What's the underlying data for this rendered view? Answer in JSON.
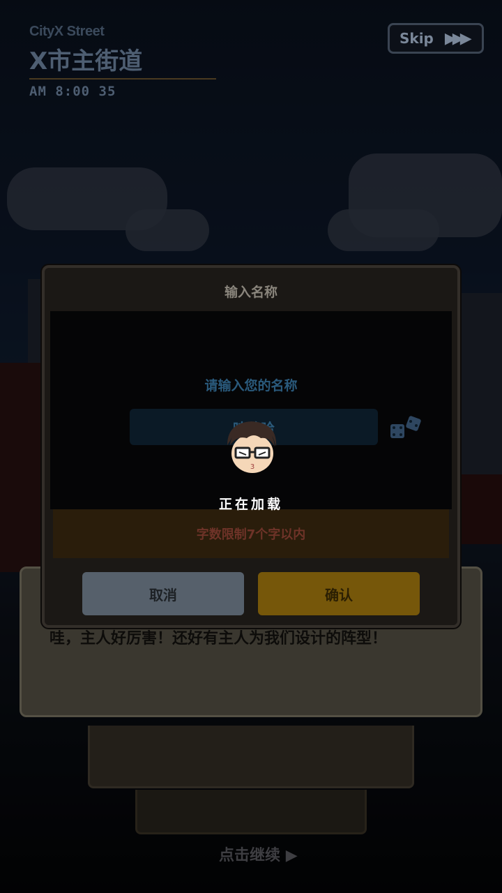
{
  "header": {
    "location_en": "CityX Street",
    "location_cn": "X市主街道",
    "time": "AM 8:00 35",
    "skip_label": "Skip"
  },
  "dialogue": {
    "text": "哇，主人好厉害！还好有主人为我们设计的阵型！",
    "continue_label": "点击继续"
  },
  "modal": {
    "title": "输入名称",
    "prompt": "请输入您的名称",
    "name_value": "哇哈哈",
    "limit_text": "字数限制7个字以内",
    "cancel_label": "取消",
    "confirm_label": "确认"
  },
  "loading": {
    "text": "正在加载"
  },
  "colors": {
    "confirm": "#76570a",
    "cancel": "#56606b",
    "prompt": "#2a5a7c",
    "warning": "#6e3328"
  }
}
